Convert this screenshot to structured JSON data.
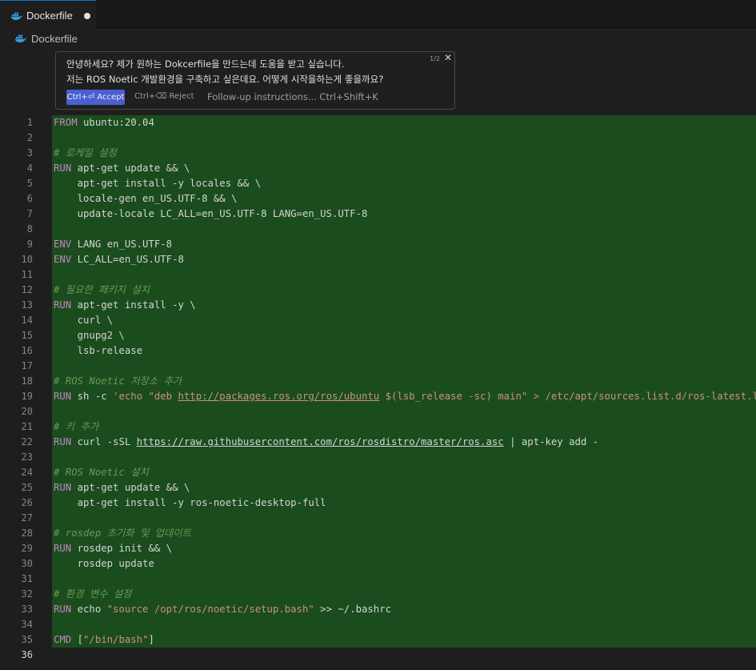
{
  "tab": {
    "filename": "Dockerfile",
    "icon": "docker-icon",
    "dirty": true
  },
  "breadcrumb": {
    "filename": "Dockerfile",
    "icon": "docker-icon"
  },
  "chat": {
    "line1": "안녕하세요? 제가 원하는 Dokcerfile을 만드는데 도움을 받고 싶습니다.",
    "line2": "저는 ROS Noetic 개발환경을 구축하고 싶은데요. 어떻게 시작을하는게 좋을까요?",
    "counter": "1/2",
    "close_icon": "close-icon",
    "accept_label": "Ctrl+⏎ Accept",
    "reject_label": "Ctrl+⌫ Reject",
    "followup_placeholder": "Follow-up instructions... Ctrl+Shift+K"
  },
  "colors": {
    "keyword": "#c586c0",
    "comment": "#6a9955",
    "string": "#ce9178",
    "added_background": "#1a4c1e",
    "accept_button": "#4a5fd0"
  },
  "code": {
    "current_line": 36,
    "lines": [
      {
        "n": "1",
        "tokens": [
          [
            "kw",
            "FROM"
          ],
          [
            "t",
            " ubuntu:20.04"
          ]
        ]
      },
      {
        "n": "2",
        "tokens": []
      },
      {
        "n": "3",
        "tokens": [
          [
            "cmt",
            "# 로케일 설정"
          ]
        ]
      },
      {
        "n": "4",
        "tokens": [
          [
            "kw",
            "RUN"
          ],
          [
            "t",
            " apt-get update && \\"
          ]
        ]
      },
      {
        "n": "5",
        "tokens": [
          [
            "t",
            "    apt-get install -y locales && \\"
          ]
        ]
      },
      {
        "n": "6",
        "tokens": [
          [
            "t",
            "    locale-gen en_US.UTF-8 && \\"
          ]
        ]
      },
      {
        "n": "7",
        "tokens": [
          [
            "t",
            "    update-locale LC_ALL=en_US.UTF-8 LANG=en_US.UTF-8"
          ]
        ]
      },
      {
        "n": "8",
        "tokens": []
      },
      {
        "n": "9",
        "tokens": [
          [
            "kw",
            "ENV"
          ],
          [
            "t",
            " LANG en_US.UTF-8"
          ]
        ]
      },
      {
        "n": "10",
        "tokens": [
          [
            "kw",
            "ENV"
          ],
          [
            "t",
            " LC_ALL=en_US.UTF-8"
          ]
        ]
      },
      {
        "n": "11",
        "tokens": []
      },
      {
        "n": "12",
        "tokens": [
          [
            "cmt",
            "# 필요한 패키지 설치"
          ]
        ]
      },
      {
        "n": "13",
        "tokens": [
          [
            "kw",
            "RUN"
          ],
          [
            "t",
            " apt-get install -y \\"
          ]
        ]
      },
      {
        "n": "14",
        "tokens": [
          [
            "t",
            "    curl \\"
          ]
        ]
      },
      {
        "n": "15",
        "tokens": [
          [
            "t",
            "    gnupg2 \\"
          ]
        ]
      },
      {
        "n": "16",
        "tokens": [
          [
            "t",
            "    lsb-release"
          ]
        ]
      },
      {
        "n": "17",
        "tokens": []
      },
      {
        "n": "18",
        "tokens": [
          [
            "cmt",
            "# ROS Noetic 저장소 추가"
          ]
        ]
      },
      {
        "n": "19",
        "tokens": [
          [
            "kw",
            "RUN"
          ],
          [
            "t",
            " sh -c "
          ],
          [
            "str",
            "'echo \"deb "
          ],
          [
            "url",
            "http://packages.ros.org/ros/ubuntu"
          ],
          [
            "str",
            " $(lsb_release -sc) main\" > /etc/apt/sources.list.d/ros-latest.list'"
          ]
        ]
      },
      {
        "n": "20",
        "tokens": []
      },
      {
        "n": "21",
        "tokens": [
          [
            "cmt",
            "# 키 추가"
          ]
        ]
      },
      {
        "n": "22",
        "tokens": [
          [
            "kw",
            "RUN"
          ],
          [
            "t",
            " curl -sSL "
          ],
          [
            "urlp",
            "https://raw.githubusercontent.com/ros/rosdistro/master/ros.asc"
          ],
          [
            "t",
            " | apt-key add -"
          ]
        ]
      },
      {
        "n": "23",
        "tokens": []
      },
      {
        "n": "24",
        "tokens": [
          [
            "cmt",
            "# ROS Noetic 설치"
          ]
        ]
      },
      {
        "n": "25",
        "tokens": [
          [
            "kw",
            "RUN"
          ],
          [
            "t",
            " apt-get update && \\"
          ]
        ]
      },
      {
        "n": "26",
        "tokens": [
          [
            "t",
            "    apt-get install -y ros-noetic-desktop-full"
          ]
        ]
      },
      {
        "n": "27",
        "tokens": []
      },
      {
        "n": "28",
        "tokens": [
          [
            "cmt",
            "# rosdep 초기화 및 업데이트"
          ]
        ]
      },
      {
        "n": "29",
        "tokens": [
          [
            "kw",
            "RUN"
          ],
          [
            "t",
            " rosdep init && \\"
          ]
        ]
      },
      {
        "n": "30",
        "tokens": [
          [
            "t",
            "    rosdep update"
          ]
        ]
      },
      {
        "n": "31",
        "tokens": []
      },
      {
        "n": "32",
        "tokens": [
          [
            "cmt",
            "# 환경 변수 설정"
          ]
        ]
      },
      {
        "n": "33",
        "tokens": [
          [
            "kw",
            "RUN"
          ],
          [
            "t",
            " echo "
          ],
          [
            "str",
            "\"source /opt/ros/noetic/setup.bash\""
          ],
          [
            "t",
            " >> ~/.bashrc"
          ]
        ]
      },
      {
        "n": "34",
        "tokens": []
      },
      {
        "n": "35",
        "tokens": [
          [
            "kw",
            "CMD"
          ],
          [
            "t",
            " ["
          ],
          [
            "str",
            "\"/bin/bash\""
          ],
          [
            "t",
            "]"
          ]
        ]
      },
      {
        "n": "36",
        "tokens": []
      }
    ]
  }
}
